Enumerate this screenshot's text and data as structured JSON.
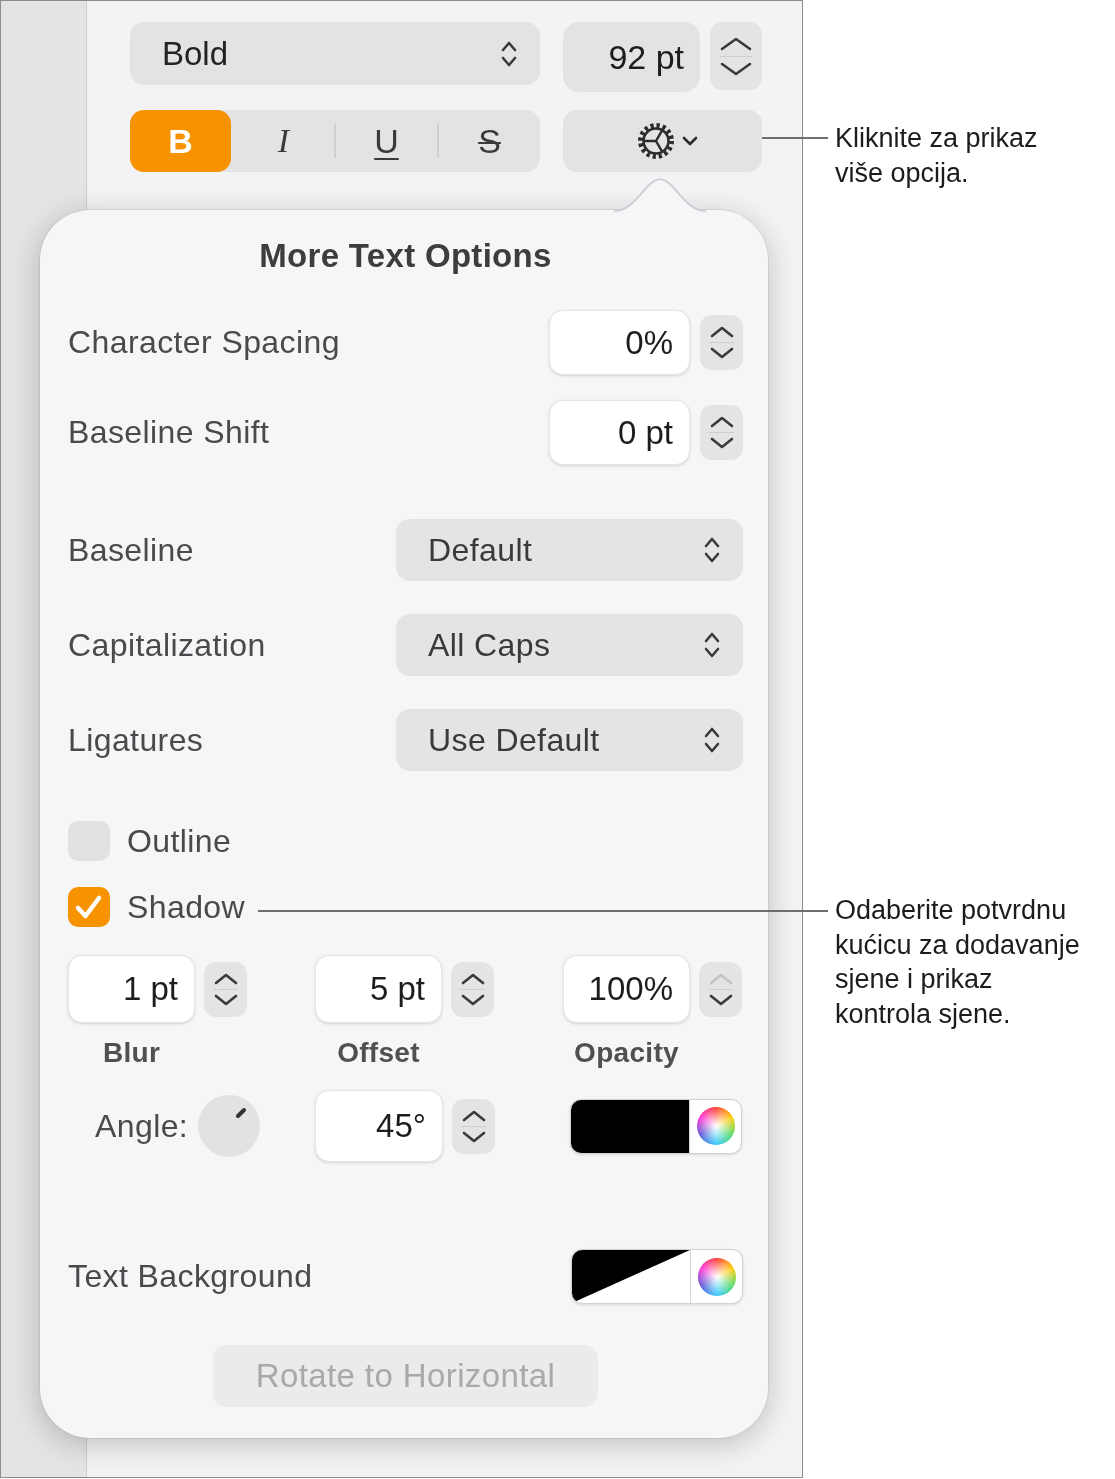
{
  "toolbar": {
    "font_style": {
      "value": "Bold"
    },
    "font_size": {
      "value": "92 pt"
    },
    "style_buttons": [
      {
        "label": "B",
        "kind": "bold",
        "selected": true
      },
      {
        "label": "I",
        "kind": "italic",
        "selected": false
      },
      {
        "label": "U",
        "kind": "underline",
        "selected": false
      },
      {
        "label": "S",
        "kind": "strikethrough",
        "selected": false
      }
    ]
  },
  "popover": {
    "title": "More Text Options",
    "rows": [
      {
        "kind": "stepper",
        "label": "Character Spacing",
        "value": "0%"
      },
      {
        "kind": "stepper",
        "label": "Baseline Shift",
        "value": "0 pt"
      },
      {
        "kind": "popup",
        "label": "Baseline",
        "value": "Default"
      },
      {
        "kind": "popup",
        "label": "Capitalization",
        "value": "All Caps"
      },
      {
        "kind": "popup",
        "label": "Ligatures",
        "value": "Use Default"
      }
    ],
    "checkboxes": [
      {
        "label": "Outline",
        "checked": false
      },
      {
        "label": "Shadow",
        "checked": true
      }
    ],
    "shadow": {
      "fields": [
        {
          "label": "Blur",
          "value": "1 pt",
          "increment_disabled": false
        },
        {
          "label": "Offset",
          "value": "5 pt",
          "increment_disabled": false
        },
        {
          "label": "Opacity",
          "value": "100%",
          "increment_disabled": true
        }
      ],
      "angle": {
        "label": "Angle:",
        "value": "45°"
      },
      "color": "#000000"
    },
    "text_background": {
      "label": "Text Background"
    },
    "rotate_button": {
      "label": "Rotate to Horizontal",
      "disabled": true
    }
  },
  "callouts": [
    {
      "text": "Kliknite za prikaz\nviše opcija."
    },
    {
      "text": "Odaberite potvrdnu\nkućicu za dodavanje\nsjene i prikaz\nkontrola sjene."
    }
  ]
}
